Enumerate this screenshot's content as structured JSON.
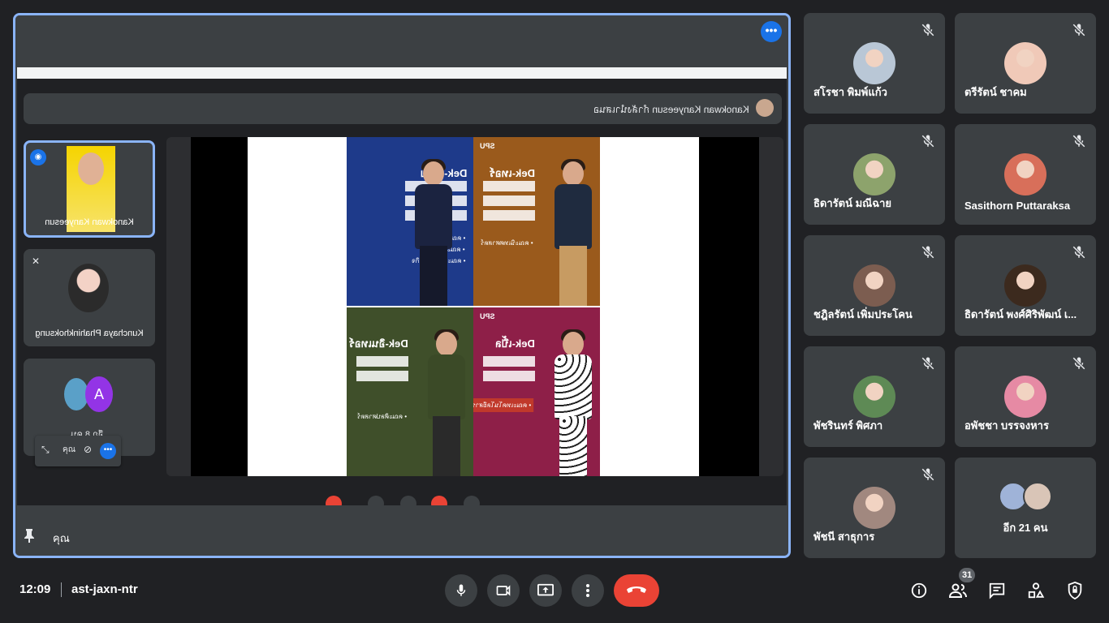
{
  "presentation": {
    "mirror_banner_text": "Kanokwan Kanyeesun กำลังนำเสนอ",
    "mini_tiles": [
      {
        "name": "Kanokwan Kanyeesun"
      },
      {
        "name": "Kunchaya Phahinkhoksung"
      },
      {
        "more_text": "อีก 8 คน",
        "avatar_letter": "A"
      }
    ],
    "mini_controls": {
      "label": "คุณ"
    },
    "slide": {
      "logo": "SPU",
      "panels": [
        {
          "title": "Dek-เนี้ยบ",
          "lines": [
            "• คณะบัญชี",
            "• คณะนิเทศ",
            "• คณะ บริหารธุรกิจ"
          ],
          "color": "#1e3a8a"
        },
        {
          "title": "Dek-เทอร์",
          "lines": [
            "• คณะนิเทศศาสตร์"
          ],
          "color": "#9a5a1c"
        },
        {
          "title": "Dek-อินเทอร์",
          "lines": [
            "• คณะศิลปศาสตร์"
          ],
          "color": "#3f4f2a"
        },
        {
          "title": "Dek-เปิ้ล",
          "lines": [
            "• คณะเทคโนโลยีสารสนเทศ"
          ],
          "color": "#8e1f48"
        }
      ]
    },
    "presenter_label": "คุณ"
  },
  "participants": [
    {
      "name": "สโรชา พิมพ์แก้ว",
      "avatar_color": "#b9c7d6"
    },
    {
      "name": "ตรีรัตน์ ชาคม",
      "avatar_color": "#f0c9b8"
    },
    {
      "name": "ธิดารัตน์ มณีฉาย",
      "avatar_color": "#8da36c"
    },
    {
      "name": "Sasithorn Puttaraksa",
      "avatar_color": "#d86f5a"
    },
    {
      "name": "ชฎิลรัตน์ เพิ่มประโคน",
      "avatar_color": "#7c5d50"
    },
    {
      "name": "ธิดารัตน์ พงศ์ศิริพัฒน์ เ...",
      "avatar_color": "#3c2a1e"
    },
    {
      "name": "พัชรินทร์ พิศภา",
      "avatar_color": "#5e8a55"
    },
    {
      "name": "อพัชชา บรรจงหาร",
      "avatar_color": "#e68aa4"
    },
    {
      "name": "พัชนี สาธุการ",
      "avatar_color": "#a1887f"
    }
  ],
  "more_participants": {
    "text": "อีก 21 คน"
  },
  "bottom_bar": {
    "time": "12:09",
    "meeting_code": "ast-jaxn-ntr",
    "people_count": "31"
  },
  "colors": {
    "background": "#202124",
    "tile": "#3c4043",
    "accent": "#8ab4f8",
    "end_call": "#ea4335",
    "primary_blue": "#1a73e8"
  }
}
